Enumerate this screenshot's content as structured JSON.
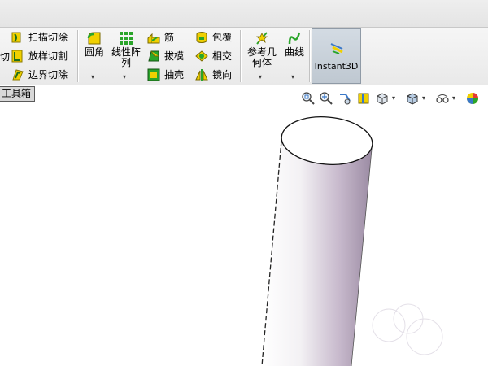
{
  "ribbon": {
    "cut_tools": {
      "partial_left_label": "切",
      "sweep_cut": "扫描切除",
      "loft_cut": "放样切割",
      "boundary_cut": "边界切除"
    },
    "fillet": "圆角",
    "linear_pattern_line1": "线性阵",
    "linear_pattern_line2": "列",
    "rib": "筋",
    "draft": "拔模",
    "shell": "抽壳",
    "wrap": "包覆",
    "intersect": "相交",
    "mirror": "镜向",
    "ref_geometry_line1": "参考几",
    "ref_geometry_line2": "何体",
    "curves": "曲线",
    "instant3d": "Instant3D",
    "dropdown_arrow": "▾"
  },
  "toolbox_tab": "工具箱",
  "view_toolbar": {
    "icons": [
      "zoom-to-fit-icon",
      "zoom-area-icon",
      "previous-view-icon",
      "section-view-icon",
      "view-orientation-icon",
      "display-style-icon",
      "hide-show-icon",
      "appearance-icon"
    ]
  },
  "colors": {
    "accent": "#f0d000",
    "icon_green": "#2aa52a",
    "cylinder_shade": "#a99ab0"
  }
}
